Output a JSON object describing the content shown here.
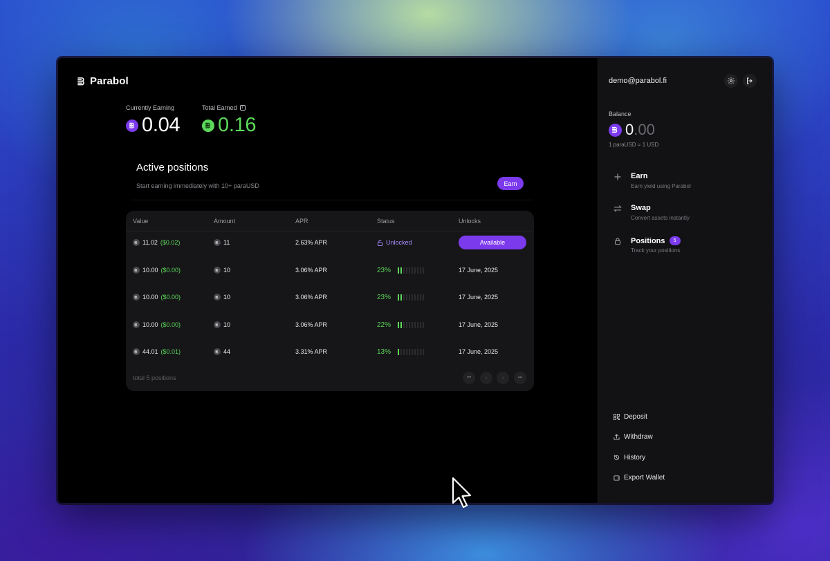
{
  "app": {
    "name": "Parabol",
    "colors": {
      "accent": "#7c3aed",
      "positive": "#5cd85a"
    }
  },
  "stats": {
    "currently_earning": {
      "label": "Currently Earning",
      "value": "0.04",
      "icon": "parausd-coin-icon"
    },
    "total_earned": {
      "label": "Total Earned",
      "value": "0.16",
      "icon": "parausd-coin-icon",
      "info_icon": "info-icon"
    }
  },
  "active_positions": {
    "title": "Active positions",
    "subtitle": "Start earning immediately with 10+ paraUSD",
    "earn_label": "Earn"
  },
  "table": {
    "headers": [
      "Value",
      "Amount",
      "APR",
      "Status",
      "Unlocks"
    ],
    "rows": [
      {
        "value": "11.02",
        "usd": "($0.02)",
        "amount": "11",
        "apr": "2.63% APR",
        "status": "Unlocked",
        "progress_pct": null,
        "bars_on": null,
        "unlocks": "Available"
      },
      {
        "value": "10.00",
        "usd": "($0.00)",
        "amount": "10",
        "apr": "3.06% APR",
        "status": "23%",
        "progress_pct": 23,
        "bars_on": 2,
        "unlocks": "17 June, 2025"
      },
      {
        "value": "10.00",
        "usd": "($0.00)",
        "amount": "10",
        "apr": "3.06% APR",
        "status": "23%",
        "progress_pct": 23,
        "bars_on": 2,
        "unlocks": "17 June, 2025"
      },
      {
        "value": "10.00",
        "usd": "($0.00)",
        "amount": "10",
        "apr": "3.06% APR",
        "status": "22%",
        "progress_pct": 22,
        "bars_on": 2,
        "unlocks": "17 June, 2025"
      },
      {
        "value": "44.01",
        "usd": "($0.01)",
        "amount": "44",
        "apr": "3.31% APR",
        "status": "13%",
        "progress_pct": 13,
        "bars_on": 1,
        "unlocks": "17 June, 2025"
      }
    ],
    "total_label": "total 5 positions",
    "pager_glyphs": [
      "⏮",
      "‹",
      "›",
      "⏭"
    ]
  },
  "sidebar": {
    "email": "demo@parabol.fi",
    "settings_icon": "gear-icon",
    "logout_icon": "logout-icon",
    "balance_label": "Balance",
    "balance_int": "0",
    "balance_dec": ".00",
    "rate": "1 paraUSD = 1 USD",
    "nav": [
      {
        "title": "Earn",
        "sub": "Earn yield using Parabol",
        "icon": "plus-icon"
      },
      {
        "title": "Swap",
        "sub": "Convert assets instantly",
        "icon": "swap-icon"
      },
      {
        "title": "Positions",
        "sub": "Track your positions",
        "icon": "lock-icon",
        "badge": "5"
      }
    ],
    "actions": [
      {
        "label": "Deposit",
        "icon": "qr-code-icon"
      },
      {
        "label": "Withdraw",
        "icon": "upload-icon"
      },
      {
        "label": "History",
        "icon": "history-icon"
      },
      {
        "label": "Export Wallet",
        "icon": "wallet-icon"
      }
    ]
  }
}
